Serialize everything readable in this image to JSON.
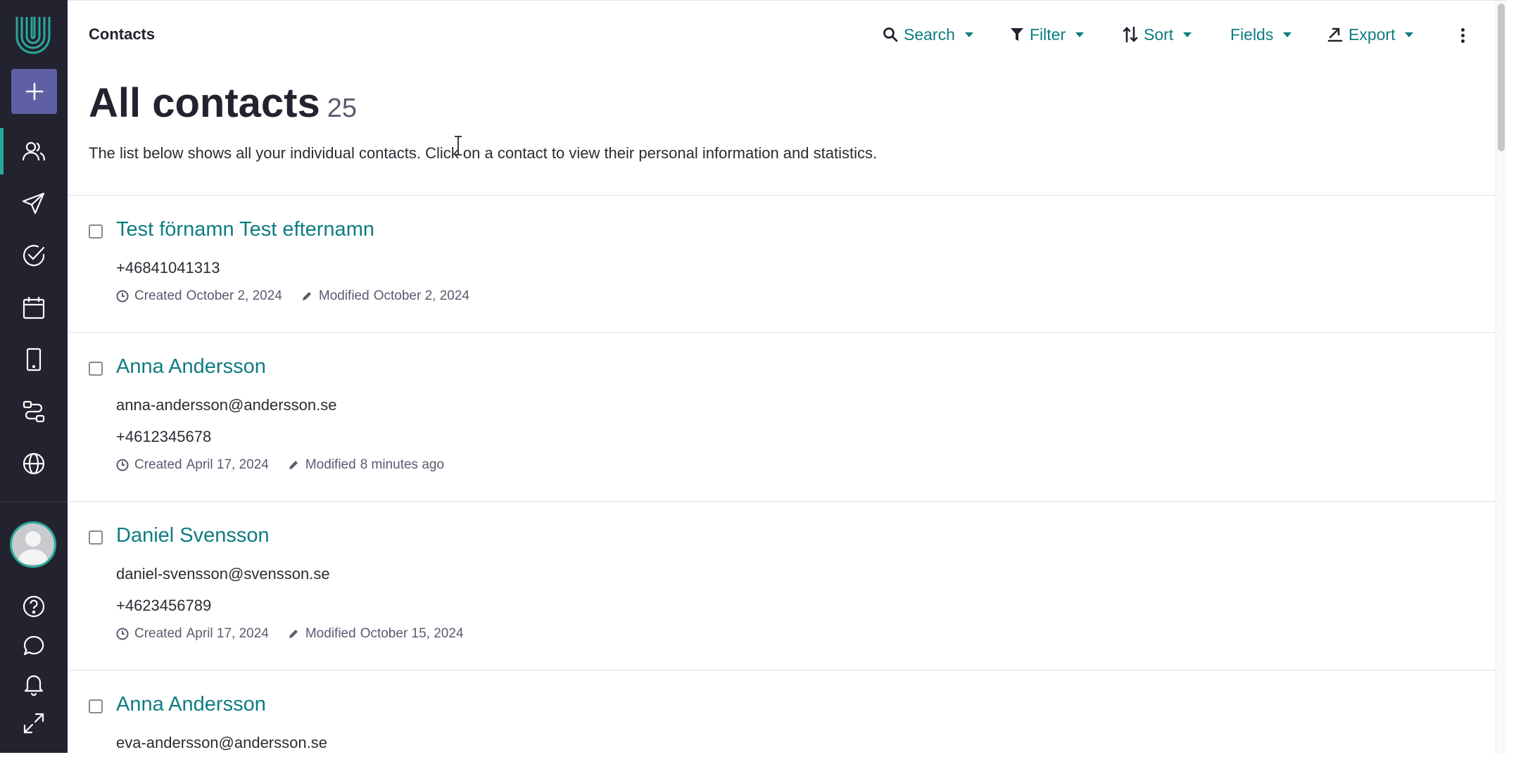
{
  "app": {
    "section": "Contacts"
  },
  "sidebar": {
    "items": [
      {
        "icon": "contacts-icon",
        "active": true
      },
      {
        "icon": "send-icon",
        "active": false
      },
      {
        "icon": "check-circle-icon",
        "active": false
      },
      {
        "icon": "calendar-icon",
        "active": false
      },
      {
        "icon": "mobile-icon",
        "active": false
      },
      {
        "icon": "workflow-icon",
        "active": false
      },
      {
        "icon": "globe-icon",
        "active": false
      }
    ],
    "bottom": [
      "help-icon",
      "chat-icon",
      "bell-icon",
      "expand-icon"
    ]
  },
  "toolbar": {
    "search": "Search",
    "filter": "Filter",
    "sort": "Sort",
    "fields": "Fields",
    "export": "Export"
  },
  "page": {
    "title": "All contacts",
    "count": "25",
    "intro": "The list below shows all your individual contacts. Click on a contact to view their personal information and statistics."
  },
  "meta_labels": {
    "created": "Created",
    "modified": "Modified"
  },
  "contacts": [
    {
      "name": "Test förnamn Test efternamn",
      "email": "",
      "phone": "+46841041313",
      "created": "October 2, 2024",
      "modified": "October 2, 2024"
    },
    {
      "name": "Anna Andersson",
      "email": "anna-andersson@andersson.se",
      "phone": "+4612345678",
      "created": "April 17, 2024",
      "modified": "8 minutes ago"
    },
    {
      "name": "Daniel Svensson",
      "email": "daniel-svensson@svensson.se",
      "phone": "+4623456789",
      "created": "April 17, 2024",
      "modified": "October 15, 2024"
    },
    {
      "name": "Anna Andersson",
      "email": "eva-andersson@andersson.se",
      "phone": "",
      "created": "",
      "modified": ""
    }
  ],
  "colors": {
    "sidebar_bg": "#22232e",
    "accent": "#2aa89a",
    "link": "#0e7c82",
    "add_button": "#5f5fa4"
  }
}
